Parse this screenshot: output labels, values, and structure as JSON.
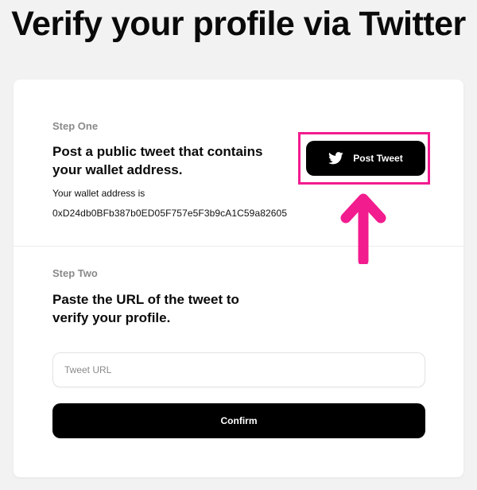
{
  "header": {
    "title": "Verify your profile via Twitter"
  },
  "step_one": {
    "label": "Step One",
    "heading_line1": "Post a public tweet that contains",
    "heading_line2": "your wallet address.",
    "wallet_label": "Your wallet address is",
    "wallet_address": "0xD24db0BFb387b0ED05F757e5F3b9cA1C59a82605",
    "post_button_label": "Post Tweet",
    "post_button_icon": "twitter-bird-icon"
  },
  "step_two": {
    "label": "Step Two",
    "heading_line1": "Paste the URL of the tweet to",
    "heading_line2": "verify your profile.",
    "input_placeholder": "Tweet URL",
    "input_value": "",
    "confirm_label": "Confirm"
  },
  "annotation": {
    "color": "#f21c8f",
    "arrow_icon": "up-arrow-icon"
  }
}
